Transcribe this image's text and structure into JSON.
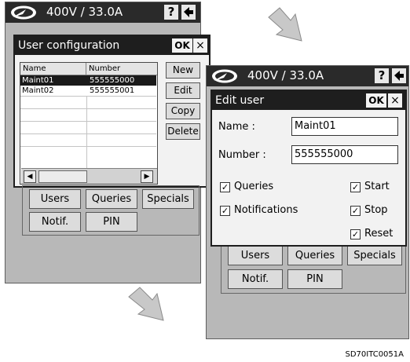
{
  "screens": [
    {
      "status": "400V / 33.0A",
      "help_glyph": "?",
      "dialog": {
        "title": "User configuration",
        "ok_label": "OK",
        "close_label": "×",
        "list": {
          "col_name": "Name",
          "col_number": "Number",
          "rows": [
            {
              "name": "Maint01",
              "number": "555555000",
              "selected": true
            },
            {
              "name": "Maint02",
              "number": "555555001",
              "selected": false
            }
          ]
        },
        "buttons": {
          "new": "New",
          "edit": "Edit",
          "copy": "Copy",
          "delete": "Delete"
        },
        "scroll_left": "◀",
        "scroll_right": "▶"
      },
      "menu": {
        "users": "Users",
        "queries": "Queries",
        "specials": "Specials",
        "notif": "Notif.",
        "pin": "PIN"
      }
    },
    {
      "status": "400V / 33.0A",
      "help_glyph": "?",
      "dialog": {
        "title": "Edit user",
        "ok_label": "OK",
        "close_label": "×",
        "name_label": "Name :",
        "name_value": "Maint01",
        "number_label": "Number :",
        "number_value": "555555000",
        "checkboxes": {
          "queries": {
            "label": "Queries",
            "checked": true
          },
          "notifications": {
            "label": "Notifications",
            "checked": true
          },
          "start": {
            "label": "Start",
            "checked": true
          },
          "stop": {
            "label": "Stop",
            "checked": true
          },
          "reset": {
            "label": "Reset",
            "checked": true
          }
        },
        "check_glyph": "✓"
      },
      "menu": {
        "users": "Users",
        "queries": "Queries",
        "specials": "Specials",
        "notif": "Notif.",
        "pin": "PIN"
      }
    }
  ],
  "icons": {
    "logo": "logo-icon",
    "help": "help-icon",
    "back": "back-icon",
    "arrow": "arrow-icon"
  },
  "colors": {
    "titlebar": "#2a2a2a",
    "screen_bg": "#b8b8b8",
    "dialog_bg": "#f2f2f2",
    "selection": "#1a1a1a",
    "arrow": "#c8c8c8"
  },
  "caption": "SD70ITC0051A"
}
